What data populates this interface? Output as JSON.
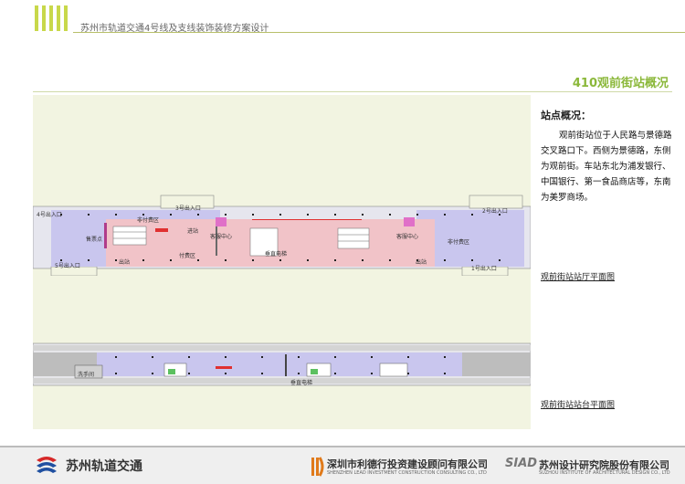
{
  "header": {
    "doc_title": "苏州市轨道交通4号线及支线装饰装修方案设计"
  },
  "section": {
    "title": "410观前街站概况"
  },
  "info": {
    "heading": "站点概况：",
    "body": "观前街站位于人民路与景德路交叉路口下。西侧为景德路，东侧为观前街。车站东北为浦发银行、中国银行、第一食品商店等，东南为美罗商场。"
  },
  "concourse": {
    "caption": "观前街站站厅平面图",
    "labels": {
      "exit4": "4号出入口",
      "exit3": "3号出入口",
      "exit2": "2号出入口",
      "exit5": "5号出入口",
      "exit1": "1号出入口",
      "ticket": "售票点",
      "nonpaid_w": "非付费区",
      "nonpaid_e": "非付费区",
      "paid": "付费区",
      "service_w": "客服中心",
      "service_e": "客服中心",
      "in": "进站",
      "out_w": "出站",
      "out_e": "出站",
      "elevator": "垂直电梯"
    }
  },
  "platform": {
    "caption": "观前街站站台平面图",
    "labels": {
      "toilet": "洗手间",
      "elevator": "垂直电梯"
    }
  },
  "footer": {
    "suzhou_logo": "苏州轨道交通",
    "lead_cn": "深圳市利德行投资建设顾问有限公司",
    "lead_en": "SHENZHEN LEAD INVESTMENT CONSTRUCTION CONSULTING CO., LTD",
    "siad_mark": "SIAD",
    "siad_cn": "苏州设计研究院股份有限公司",
    "siad_en": "SUZHOU INSTITUTE OF ARCHITECTURAL DESIGN CO., LTD"
  },
  "colors": {
    "accent": "#8bb83a",
    "panel": "#f2f4e1",
    "nonpaid": "#c9c6ee",
    "paid": "#f1c3c8",
    "service": "#e070c8"
  }
}
